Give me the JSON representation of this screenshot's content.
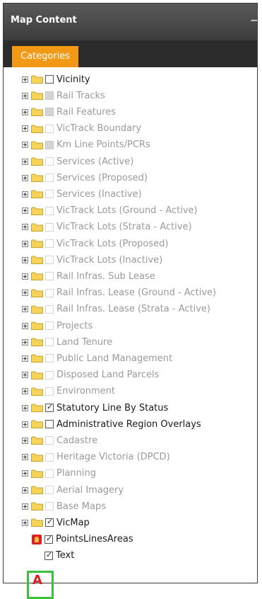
{
  "panel": {
    "title": "Map Content",
    "collapse_glyph": "−"
  },
  "tabs": [
    {
      "label": "Categories",
      "active": true
    }
  ],
  "tree": [
    {
      "label": "Vicinity",
      "checkbox": "dark",
      "checked": false,
      "active": true
    },
    {
      "label": "Rail Tracks",
      "checkbox": "grey",
      "checked": false,
      "active": false
    },
    {
      "label": "Rail Features",
      "checkbox": "grey",
      "checked": false,
      "active": false
    },
    {
      "label": "VicTrack Boundary",
      "checkbox": "faint",
      "checked": false,
      "active": false
    },
    {
      "label": "Km Line Points/PCRs",
      "checkbox": "grey",
      "checked": false,
      "active": false
    },
    {
      "label": "Services (Active)",
      "checkbox": "faint",
      "checked": false,
      "active": false
    },
    {
      "label": "Services (Proposed)",
      "checkbox": "faint",
      "checked": false,
      "active": false
    },
    {
      "label": "Services (Inactive)",
      "checkbox": "faint",
      "checked": false,
      "active": false
    },
    {
      "label": "VicTrack Lots (Ground - Active)",
      "checkbox": "faint",
      "checked": false,
      "active": false
    },
    {
      "label": "VicTrack Lots (Strata - Active)",
      "checkbox": "faint",
      "checked": false,
      "active": false
    },
    {
      "label": "VicTrack Lots (Proposed)",
      "checkbox": "faint",
      "checked": false,
      "active": false
    },
    {
      "label": "VicTrack Lots (Inactive)",
      "checkbox": "faint",
      "checked": false,
      "active": false
    },
    {
      "label": "Rail Infras. Sub Lease",
      "checkbox": "faint",
      "checked": false,
      "active": false
    },
    {
      "label": "Rail Infras. Lease (Ground - Active)",
      "checkbox": "faint",
      "checked": false,
      "active": false
    },
    {
      "label": "Rail Infras. Lease (Strata - Active)",
      "checkbox": "faint",
      "checked": false,
      "active": false
    },
    {
      "label": "Projects",
      "checkbox": "faint",
      "checked": false,
      "active": false
    },
    {
      "label": "Land Tenure",
      "checkbox": "faint",
      "checked": false,
      "active": false
    },
    {
      "label": "Public Land Management",
      "checkbox": "faint",
      "checked": false,
      "active": false
    },
    {
      "label": "Disposed Land Parcels",
      "checkbox": "faint",
      "checked": false,
      "active": false
    },
    {
      "label": "Environment",
      "checkbox": "faint",
      "checked": false,
      "active": false
    },
    {
      "label": "Statutory Line By Status",
      "checkbox": "dark",
      "checked": true,
      "active": true
    },
    {
      "label": "Administrative Region Overlays",
      "checkbox": "dark",
      "checked": false,
      "active": true
    },
    {
      "label": "Cadastre",
      "checkbox": "faint",
      "checked": false,
      "active": false
    },
    {
      "label": "Heritage Victoria (DPCD)",
      "checkbox": "faint",
      "checked": false,
      "active": false
    },
    {
      "label": "Planning",
      "checkbox": "faint",
      "checked": false,
      "active": false
    },
    {
      "label": "Aerial Imagery",
      "checkbox": "faint",
      "checked": false,
      "active": false
    },
    {
      "label": "Base Maps",
      "checkbox": "faint",
      "checked": false,
      "active": false
    },
    {
      "label": "VicMap",
      "checkbox": "dark",
      "checked": true,
      "active": true
    }
  ],
  "children": [
    {
      "label": "PointsLinesAreas",
      "icon": "layer-warning-icon",
      "checked": true
    },
    {
      "label": "Text",
      "icon": "none",
      "checked": true
    }
  ],
  "annotation": {
    "letter": "A",
    "box_color": "#3cbf3c",
    "letter_color": "#d81e1e"
  },
  "colors": {
    "tab_accent": "#f29a16",
    "titlebar": "#3c3c3c",
    "folder": "#f5d45e"
  }
}
